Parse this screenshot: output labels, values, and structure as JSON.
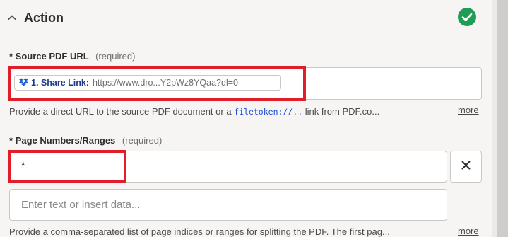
{
  "section": {
    "title": "Action",
    "status_color": "#1f9d55"
  },
  "source_pdf": {
    "label_prefix": "*",
    "label": "Source PDF URL",
    "required": "(required)",
    "pill_icon": "dropbox-icon",
    "pill_name": "1. Share Link:",
    "pill_value": "https://www.dro...Y2pWz8YQaa?dl=0",
    "help_before": "Provide a direct URL to the source PDF document or a",
    "help_code": "filetoken://..",
    "help_after": "link from PDF.co...",
    "more": "more"
  },
  "page_numbers": {
    "label_prefix": "*",
    "label": "Page Numbers/Ranges",
    "required": "(required)",
    "value": "*",
    "clear_icon": "close-icon",
    "new_placeholder": "Enter text or insert data...",
    "help": "Provide a comma-separated list of page indices or ranges for splitting the PDF. The first pag...",
    "more": "more"
  },
  "highlight_color": "#e11d2a"
}
